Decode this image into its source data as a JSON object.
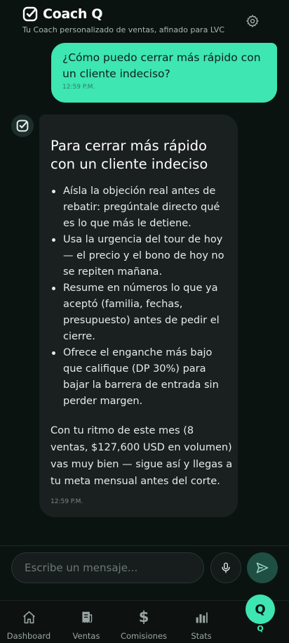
{
  "header": {
    "title": "Coach Q",
    "subtitle": "Tu Coach personalizado de ventas, afinado para LVC",
    "brand_icon": "check-badge-icon",
    "settings_icon": "gear-icon"
  },
  "messages": [
    {
      "role": "user",
      "text": "¿Cómo puedo cerrar más rápido con un cliente indeciso?",
      "time": "12:59 P.M."
    },
    {
      "role": "bot",
      "avatar_icon": "check-badge-icon",
      "heading": "Para cerrar más rápido con un cliente indeciso",
      "bullets": [
        "Aísla la objeción real antes de rebatir: pregúntale directo qué es lo que más le detiene.",
        "Usa la urgencia del tour de hoy — el precio y el bono de hoy no se repiten mañana.",
        "Resume en números lo que ya aceptó (familia, fechas, presupuesto) antes de pedir el cierre.",
        "Ofrece el enganche más bajo que califique (DP 30%) para bajar la barrera de entrada sin perder margen."
      ],
      "paragraph": "Con tu ritmo de este mes (8 ventas, $127,600 USD en volumen) vas muy bien — sigue así y llegas a tu meta mensual antes del corte.",
      "time": "12:59 P.M."
    }
  ],
  "composer": {
    "placeholder": "Escribe un mensaje...",
    "value": "",
    "mic_icon": "microphone-icon",
    "send_icon": "send-icon"
  },
  "nav": {
    "items": [
      {
        "label": "Dashboard",
        "icon": "home-icon"
      },
      {
        "label": "Ventas",
        "icon": "receipt-icon"
      },
      {
        "label": "Comisiones",
        "icon": "dollar-icon"
      },
      {
        "label": "Stats",
        "icon": "bar-chart-icon"
      }
    ],
    "active": {
      "label": "Q",
      "badge": "Q"
    }
  },
  "colors": {
    "accent": "#3ee6b1",
    "background": "#0b1311",
    "bubble_bot": "#1a201f"
  }
}
